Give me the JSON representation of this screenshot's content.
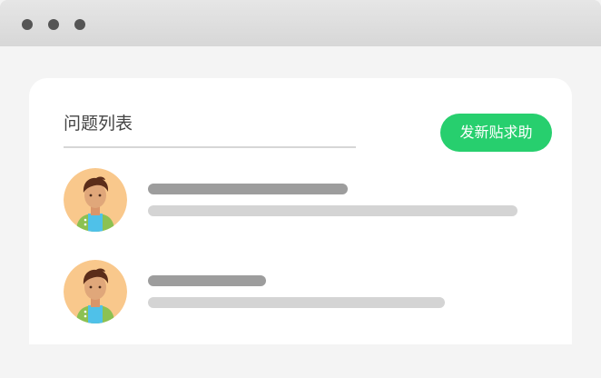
{
  "window": {
    "controls": [
      "window-dot",
      "window-dot",
      "window-dot"
    ]
  },
  "list": {
    "title": "问题列表",
    "post_button_label": "发新贴求助",
    "items": [
      {
        "avatar": "person-avatar"
      },
      {
        "avatar": "person-avatar"
      }
    ]
  },
  "colors": {
    "accent": "#27cf6e",
    "page_background": "#f4f4f4",
    "titlebar": "#d9d9d9",
    "placeholder_dark": "#9d9d9d",
    "placeholder_light": "#d4d4d4",
    "avatar_background": "#f9c88c"
  }
}
